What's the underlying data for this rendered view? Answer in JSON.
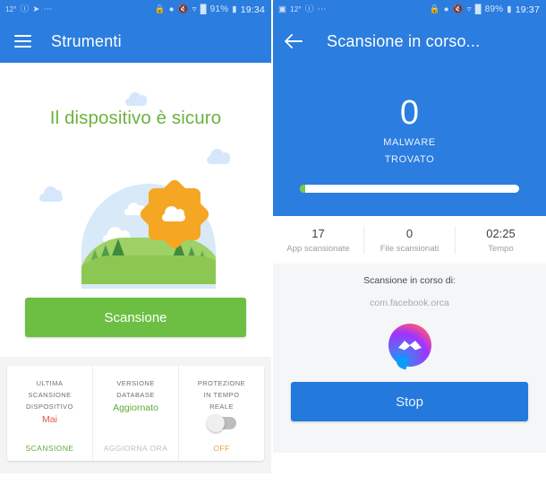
{
  "left_screen": {
    "status_bar": {
      "temperature": "12°",
      "icons_left": [
        "alert-circle-icon",
        "telegram-icon",
        "more-dots-icon"
      ],
      "icons_right": [
        "vpn-key-icon",
        "location-icon",
        "mute-icon",
        "wifi-icon",
        "signal-icon"
      ],
      "battery": "91%",
      "time": "19:34"
    },
    "appbar": {
      "menu_icon": "hamburger-icon",
      "title": "Strumenti"
    },
    "hero": {
      "title": "Il dispositivo è sicuro"
    },
    "scan_button": {
      "label": "Scansione"
    },
    "cards": [
      {
        "title": "ULTIMA\nSCANSIONE\nDISPOSITIVO",
        "title_lines": [
          "ULTIMA",
          "SCANSIONE",
          "DISPOSITIVO"
        ],
        "value": "Mai",
        "value_color": "#e2574c",
        "action": "SCANSIONE",
        "action_color": "#62a83c"
      },
      {
        "title_lines": [
          "VERSIONE",
          "DATABASE"
        ],
        "value": "Aggiornato",
        "value_color": "#62a83c",
        "action": "AGGIORNA ORA",
        "action_color": "#bfc1c4"
      },
      {
        "title_lines": [
          "PROTEZIONE",
          "IN TEMPO",
          "REALE"
        ],
        "toggle_state": "off",
        "action": "OFF",
        "action_color": "#e9a13b"
      }
    ]
  },
  "right_screen": {
    "status_bar": {
      "temperature": "12°",
      "icons_left": [
        "image-icon",
        "alert-circle-icon",
        "more-dots-icon"
      ],
      "icons_right": [
        "vpn-key-icon",
        "location-icon",
        "mute-icon",
        "wifi-icon",
        "signal-icon"
      ],
      "battery": "89%",
      "time": "19:37"
    },
    "appbar": {
      "back_icon": "back-arrow-icon",
      "title": "Scansione in corso..."
    },
    "scan_header": {
      "malware_count": "0",
      "malware_label_line1": "MALWARE",
      "malware_label_line2": "TROVATO",
      "progress_percent": 2.5
    },
    "stats": [
      {
        "value": "17",
        "label": "App scansionate"
      },
      {
        "value": "0",
        "label": "File scansionati"
      },
      {
        "value": "02:25",
        "label": "Tempo"
      }
    ],
    "scanning": {
      "label": "Scansione in corso di:",
      "package": "com.facebook.orca",
      "app_icon": "messenger-icon"
    },
    "stop_button": {
      "label": "Stop"
    }
  },
  "colors": {
    "primary_blue": "#2B7DE0",
    "green": "#6CBF43",
    "accent_green_text": "#62a83c",
    "red": "#e2574c",
    "orange": "#e9a13b",
    "bg_gray": "#f5f6f7"
  }
}
